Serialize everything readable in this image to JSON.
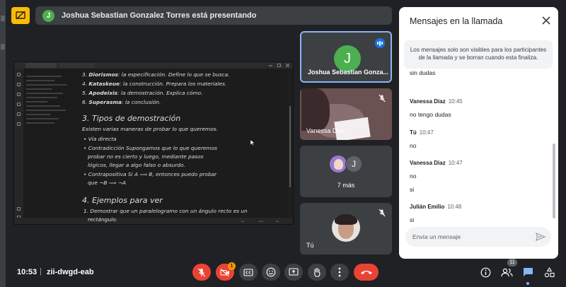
{
  "banner": {
    "avatar_initial": "J",
    "text": "Joshua Sebastian Gonzalez Torres está presentando"
  },
  "shared_doc": {
    "list_a": [
      {
        "num": "3.",
        "term": "Diorismos",
        "rest": ": la especificación. Define lo que se busca."
      },
      {
        "num": "4.",
        "term": "Kataskeue",
        "rest": ": la construcción. Prepara los materiales."
      },
      {
        "num": "5.",
        "term": "Apodeixis",
        "rest": ": la demostración. Explica cómo."
      },
      {
        "num": "6.",
        "term": "Superasma",
        "rest": ": la conclusión."
      }
    ],
    "heading_3": "3. Tipos de demostración",
    "intro": "Existen varias maneras de probar lo que queremos.",
    "bullets": [
      "• Vía directa",
      "• Contradicción Supongamos que lo que queremos",
      "probar no es cierto y luego, mediante pasos",
      "lógicos, llegar a algo falso o absurdo.",
      "• Contrapositiva Si A ⟹ B, entonces puedo probar",
      "que ¬B ⟹ ¬A"
    ],
    "heading_4": "4. Ejemplos para ver",
    "example_1": "1. Demostrar que un paralelogramo con un ángulo recto es un",
    "example_1b": "rectángulo."
  },
  "tiles": {
    "presenter": {
      "initial": "J",
      "name": "Joshua Sebastian Gonza..."
    },
    "vanessa": {
      "name": "Vanessa Diaz"
    },
    "more": {
      "initial": "J",
      "label": "7 más"
    },
    "me": {
      "name": "Tú"
    }
  },
  "chat": {
    "title": "Mensajes en la llamada",
    "notice": "Los mensajes solo son visibles para los participantes de la llamada y se borran cuando esta finaliza.",
    "partial_message": "sin dudas",
    "messages": [
      {
        "sender": "Vanessa Diaz",
        "time": "10:45",
        "lines": [
          "no tengo dudas"
        ]
      },
      {
        "sender": "Tú",
        "time": "10:47",
        "lines": [
          "no"
        ]
      },
      {
        "sender": "Vanessa Diaz",
        "time": "10:47",
        "lines": [
          "no",
          "si"
        ]
      },
      {
        "sender": "Julián Emilio",
        "time": "10:48",
        "lines": [
          "si"
        ]
      }
    ],
    "input_placeholder": "Envía un mensaje"
  },
  "bottom_bar": {
    "time": "10:53",
    "separator": "|",
    "meeting_code": "zii-dwgd-eab",
    "camera_badge": "1",
    "people_count": "11"
  },
  "colors": {
    "end_call": "#ea4335",
    "muted": "#ea4335",
    "presenting": "#fbbc04",
    "accent": "#8ab4f8"
  }
}
